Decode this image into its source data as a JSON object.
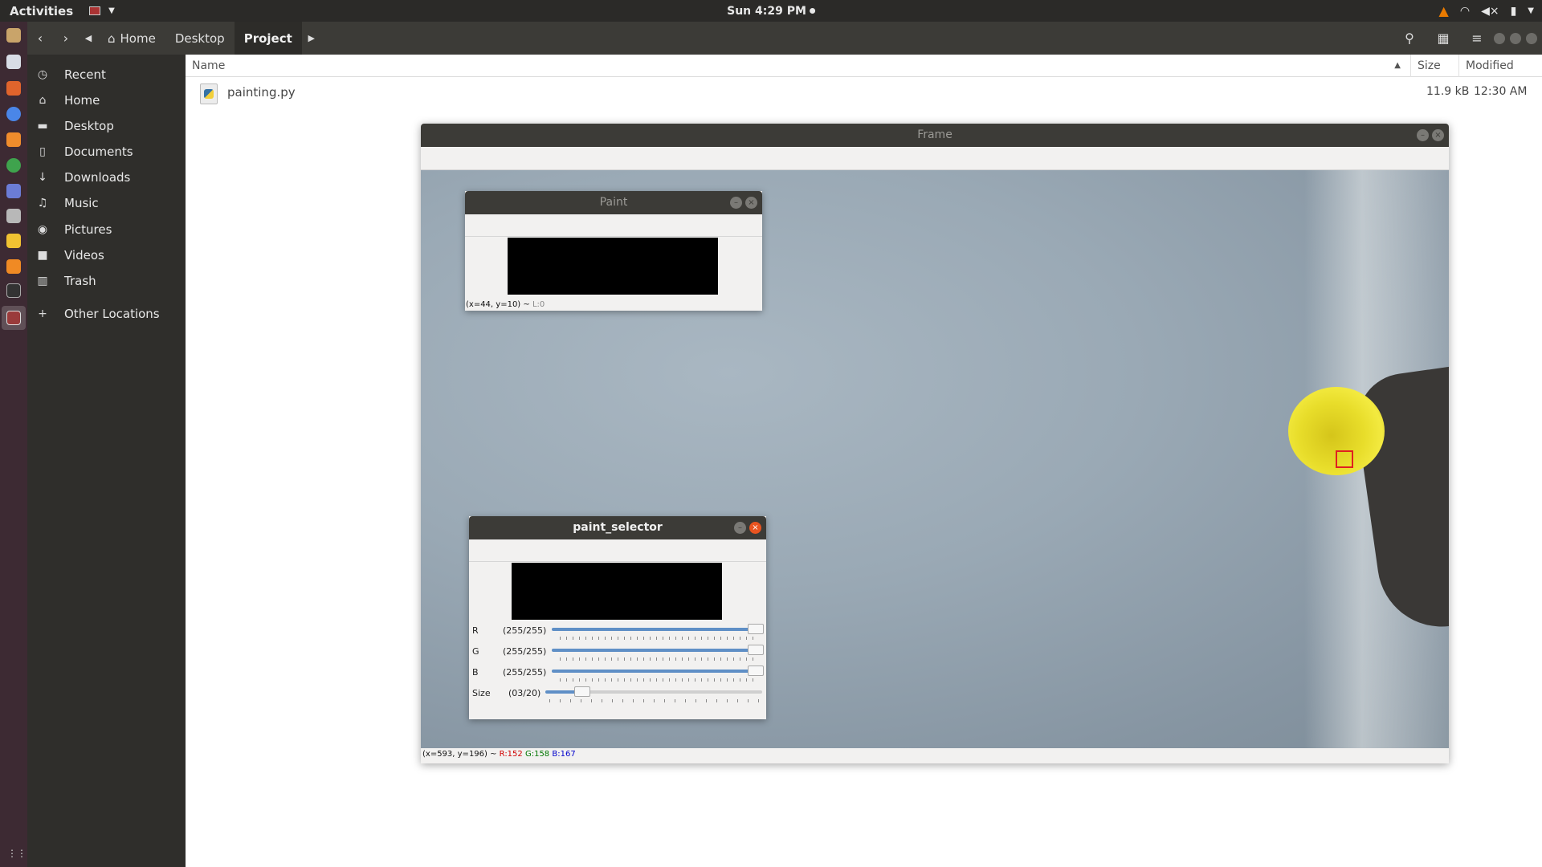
{
  "topbar": {
    "activities": "Activities",
    "clock": "Sun  4:29 PM",
    "tray_icons": [
      "vlc-icon",
      "wifi-icon",
      "volume-muted-icon",
      "battery-icon",
      "system-menu-chevron-icon"
    ]
  },
  "dock": {
    "apps": [
      "files-icon",
      "text-editor-icon",
      "software-center-icon",
      "chrome-icon",
      "sublime-icon",
      "web-browser-icon",
      "discord-icon",
      "image-viewer-icon",
      "sticky-notes-icon",
      "vlc-icon",
      "terminal-icon",
      "python-window-icon"
    ],
    "show_apps": "show-applications-icon"
  },
  "files": {
    "breadcrumbs": [
      "Home",
      "Desktop",
      "Project"
    ],
    "sidebar": [
      {
        "label": "Recent",
        "icon": "clock-icon"
      },
      {
        "label": "Home",
        "icon": "home-icon"
      },
      {
        "label": "Desktop",
        "icon": "folder-icon"
      },
      {
        "label": "Documents",
        "icon": "document-icon"
      },
      {
        "label": "Downloads",
        "icon": "download-icon"
      },
      {
        "label": "Music",
        "icon": "music-icon"
      },
      {
        "label": "Pictures",
        "icon": "camera-icon"
      },
      {
        "label": "Videos",
        "icon": "video-icon"
      },
      {
        "label": "Trash",
        "icon": "trash-icon"
      },
      {
        "label": "Other Locations",
        "icon": "plus-icon"
      }
    ],
    "columns": {
      "name": "Name",
      "size": "Size",
      "modified": "Modified"
    },
    "rows": [
      {
        "name": "painting.py",
        "size": "11.9 kB",
        "modified": "12:30 AM"
      }
    ]
  },
  "frame": {
    "title": "Frame",
    "status_prefix": "(x=593, y=196) ~ ",
    "status_r": "R:152",
    "status_g": "G:158",
    "status_b": "B:167"
  },
  "paint": {
    "title": "Paint",
    "status_prefix": "(x=44, y=10) ~ ",
    "status_l": "L:0"
  },
  "selector": {
    "title": "paint_selector",
    "trackbars": [
      {
        "label": "R",
        "value": "(255/255)",
        "fraction": 1.0
      },
      {
        "label": "G",
        "value": "(255/255)",
        "fraction": 1.0
      },
      {
        "label": "B",
        "value": "(255/255)",
        "fraction": 1.0
      },
      {
        "label": "Size",
        "value": "(03/20)",
        "fraction": 0.15
      }
    ]
  },
  "colors": {
    "ubuntu_orange": "#e95420",
    "dock_bg": "#3d2a33",
    "trackbar_fill": "#5f8fc6",
    "marker_red": "#e02020"
  }
}
